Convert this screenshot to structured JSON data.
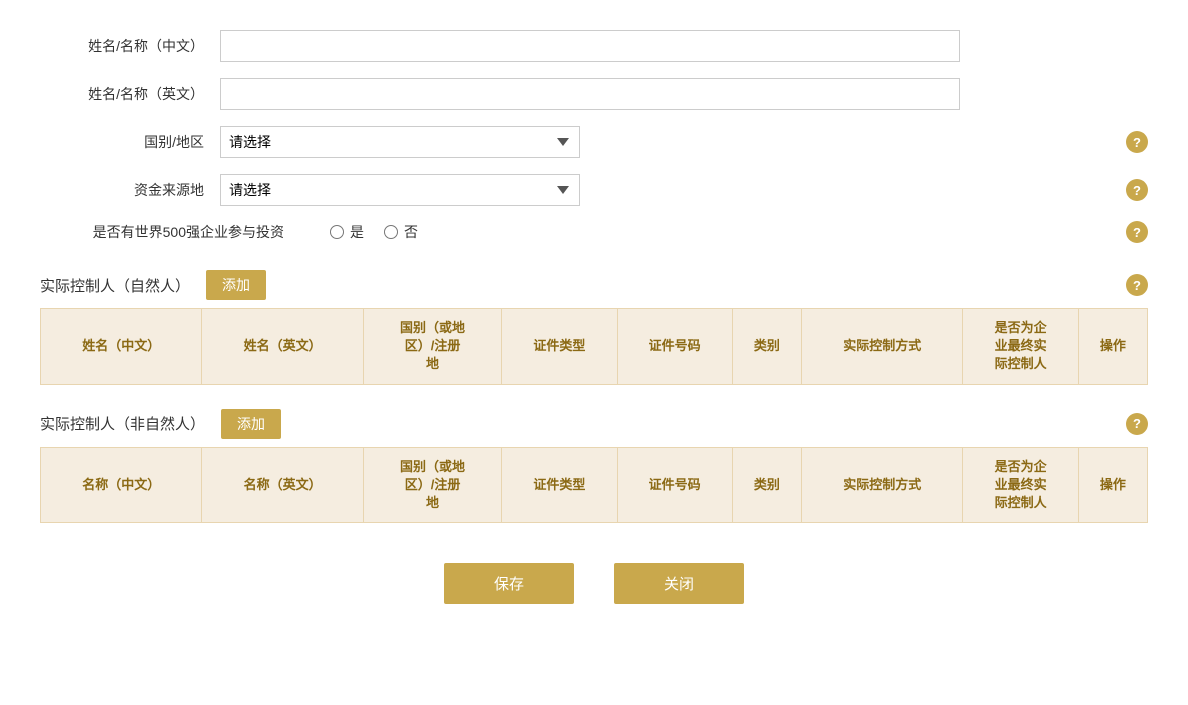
{
  "form": {
    "name_cn_label": "姓名/名称（中文）",
    "name_en_label": "姓名/名称（英文）",
    "country_label": "国别/地区",
    "country_placeholder": "请选择",
    "fund_source_label": "资金来源地",
    "fund_source_placeholder": "请选择",
    "fortune500_label": "是否有世界500强企业参与投资",
    "fortune500_yes": "是",
    "fortune500_no": "否",
    "name_cn_value": "",
    "name_en_value": ""
  },
  "section_natural": {
    "title": "实际控制人（自然人）",
    "add_label": "添加",
    "columns": [
      "姓名（中文）",
      "姓名（英文）",
      "国别（或地\n区）/注册\n地",
      "证件类型",
      "证件号码",
      "类别",
      "实际控制方式",
      "是否为企\n业最终实\n际控制人",
      "操作"
    ]
  },
  "section_non_natural": {
    "title": "实际控制人（非自然人）",
    "add_label": "添加",
    "columns": [
      "名称（中文）",
      "名称（英文）",
      "国别（或地\n区）/注册\n地",
      "证件类型",
      "证件号码",
      "类别",
      "实际控制方式",
      "是否为企\n业最终实\n际控制人",
      "操作"
    ]
  },
  "buttons": {
    "save": "保存",
    "close": "关闭"
  },
  "help": {
    "icon": "?"
  }
}
